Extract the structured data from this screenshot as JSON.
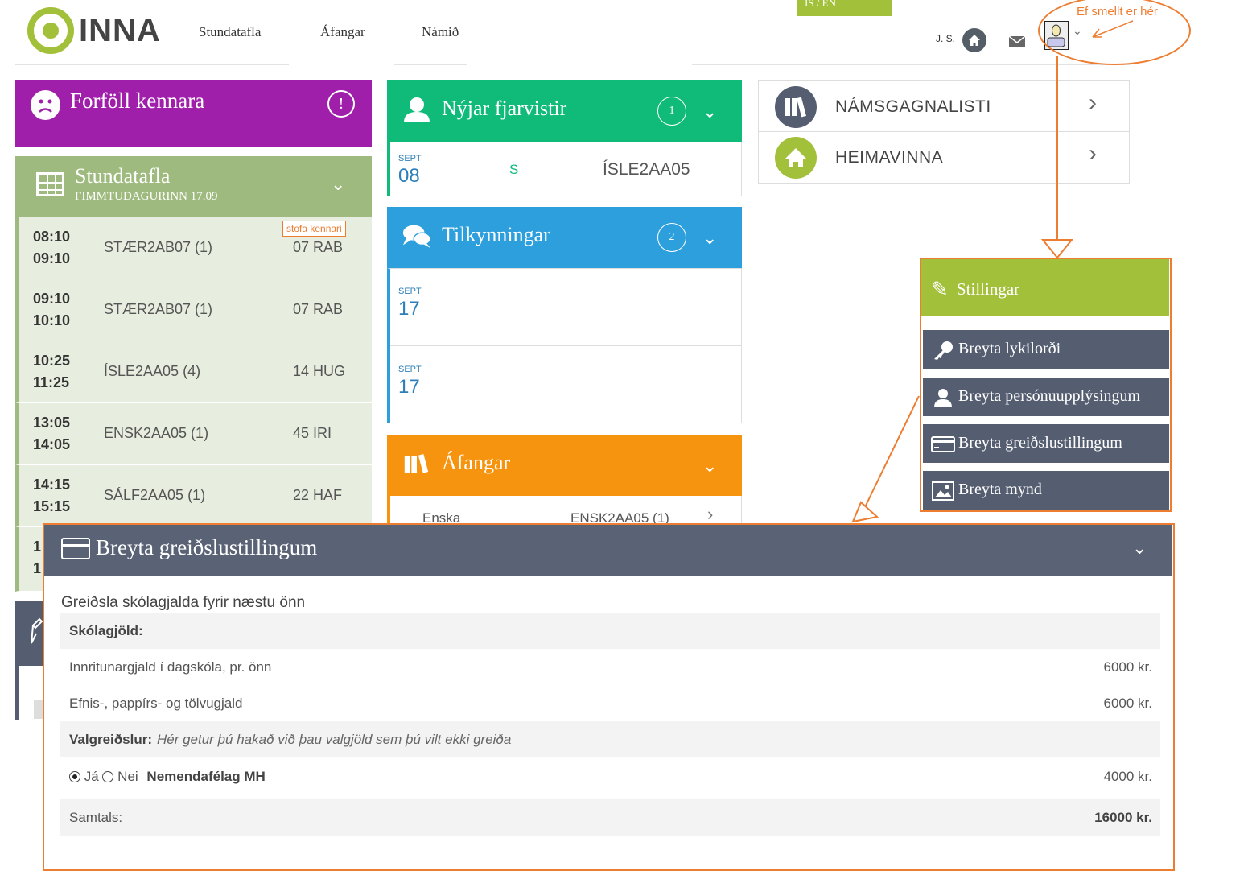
{
  "header": {
    "logo_text": "INNA",
    "nav": [
      "Stundatafla",
      "Áfangar",
      "Námið"
    ],
    "lang": "IS / EN",
    "initials": "J. S.",
    "annotation": "Ef smellt er hér"
  },
  "forfoll": {
    "title": "Forföll kennara",
    "alert": "!"
  },
  "stundatafla": {
    "title": "Stundatafla",
    "subtitle": "FIMMTUDAGURINN 17.09",
    "badge": "stofa  kennari",
    "rows": [
      {
        "start": "08:10",
        "end": "09:10",
        "course": "STÆR2AB07 (1)",
        "room": "07  RAB"
      },
      {
        "start": "09:10",
        "end": "10:10",
        "course": "STÆR2AB07 (1)",
        "room": "07  RAB"
      },
      {
        "start": "10:25",
        "end": "11:25",
        "course": "ÍSLE2AA05 (4)",
        "room": "14  HUG"
      },
      {
        "start": "13:05",
        "end": "14:05",
        "course": "ENSK2AA05 (1)",
        "room": "45  IRI"
      },
      {
        "start": "14:15",
        "end": "15:15",
        "course": "SÁLF2AA05 (1)",
        "room": "22  HAF"
      },
      {
        "start": "1",
        "end": "1",
        "course": "",
        "room": ""
      }
    ]
  },
  "fjarvistir": {
    "title": "Nýjar fjarvistir",
    "count": "1",
    "item": {
      "month": "SEPT",
      "day": "08",
      "code": "S",
      "course": "ÍSLE2AA05"
    }
  },
  "tilkynningar": {
    "title": "Tilkynningar",
    "count": "2",
    "items": [
      {
        "month": "SEPT",
        "day": "17"
      },
      {
        "month": "SEPT",
        "day": "17"
      }
    ]
  },
  "afangar": {
    "title": "Áfangar",
    "item": {
      "name": "Enska",
      "course": "ENSK2AA05 (1)"
    }
  },
  "right": {
    "namsgagnalisti": "NÁMSGAGNALISTI",
    "heimavinna": "HEIMAVINNA"
  },
  "stillingar": {
    "title": "Stillingar",
    "items": [
      "Breyta lykilorði",
      "Breyta persónuupplýsingum",
      "Breyta greiðslustillingum",
      "Breyta mynd"
    ]
  },
  "greidsla": {
    "title": "Breyta greiðslustillingum",
    "section": "Greiðsla skólagjalda fyrir næstu önn",
    "skolagjold_label": "Skólagjöld:",
    "fees": [
      {
        "label": "Innritunargjald í dagskóla, pr. önn",
        "amount": "6000 kr."
      },
      {
        "label": "Efnis-, pappírs- og tölvugjald",
        "amount": "6000 kr."
      }
    ],
    "valgreidslur_label": "Valgreiðslur:",
    "valgreidslur_hint": "Hér getur þú hakað við þau valgjöld sem þú vilt ekki greiða",
    "optional": {
      "yes": "Já",
      "no": "Nei",
      "selected": "yes",
      "label": "Nemendafélag MH",
      "amount": "4000 kr."
    },
    "total_label": "Samtals:",
    "total_amount": "16000 kr."
  },
  "colors": {
    "purple": "#a01faa",
    "olive": "#9fba7e",
    "green": "#10bb7a",
    "blue": "#2c9fdc",
    "orange": "#f7940f",
    "lime": "#a3c03b",
    "slate": "#555d70",
    "annotation": "#ed7d31"
  }
}
